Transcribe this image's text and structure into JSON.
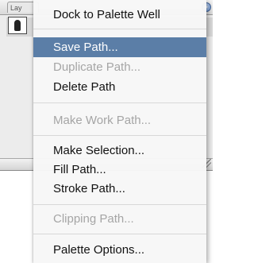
{
  "palette": {
    "tab_label": "Lay"
  },
  "menu": {
    "dock": "Dock to Palette Well",
    "save_path": "Save Path...",
    "duplicate_path": "Duplicate Path...",
    "delete_path": "Delete Path",
    "make_work_path": "Make Work Path...",
    "make_selection": "Make Selection...",
    "fill_path": "Fill Path...",
    "stroke_path": "Stroke Path...",
    "clipping_path": "Clipping Path...",
    "palette_options": "Palette Options..."
  },
  "colors": {
    "selected_highlight": "#5b7ea7",
    "disabled_text": "#a5a5a5"
  }
}
